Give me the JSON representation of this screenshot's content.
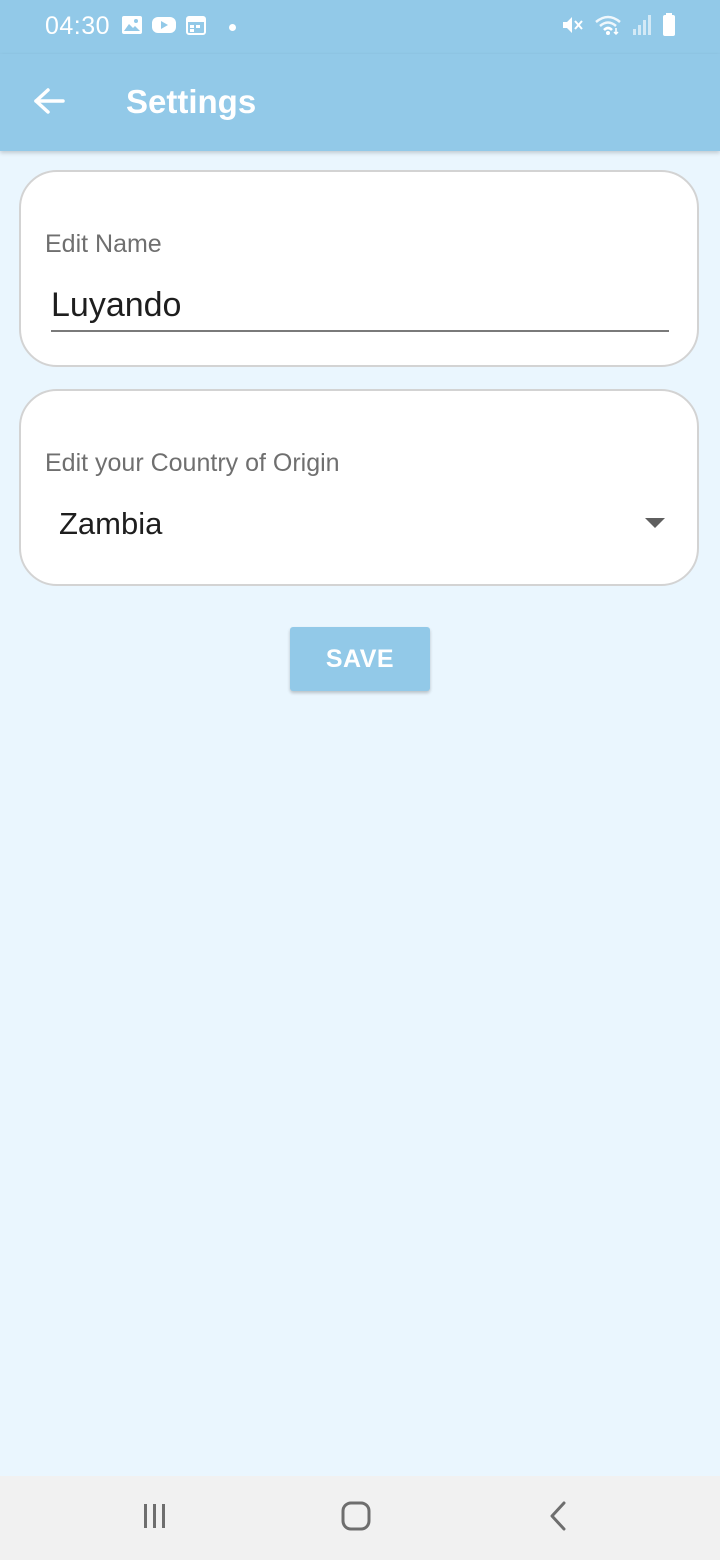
{
  "status_bar": {
    "time": "04:30",
    "icons": [
      "gallery-icon",
      "youtube-icon",
      "calendar-icon",
      "notification-dot-icon",
      "mute-icon",
      "wifi-icon",
      "signal-icon",
      "battery-icon"
    ]
  },
  "app_bar": {
    "back_icon": "arrow-left-icon",
    "title": "Settings"
  },
  "name_card": {
    "label": "Edit Name",
    "value": "Luyando"
  },
  "country_card": {
    "label": "Edit your Country of Origin",
    "selected": "Zambia",
    "dropdown_icon": "caret-down-icon"
  },
  "save_button": {
    "label": "SAVE"
  },
  "nav_bar": {
    "icons": [
      "recents-icon",
      "home-icon",
      "back-icon"
    ]
  },
  "colors": {
    "primary": "#92C9E8",
    "background": "#EAF6FE",
    "card_border": "#D3D3D3",
    "nav_bar": "#F1F1F1"
  }
}
